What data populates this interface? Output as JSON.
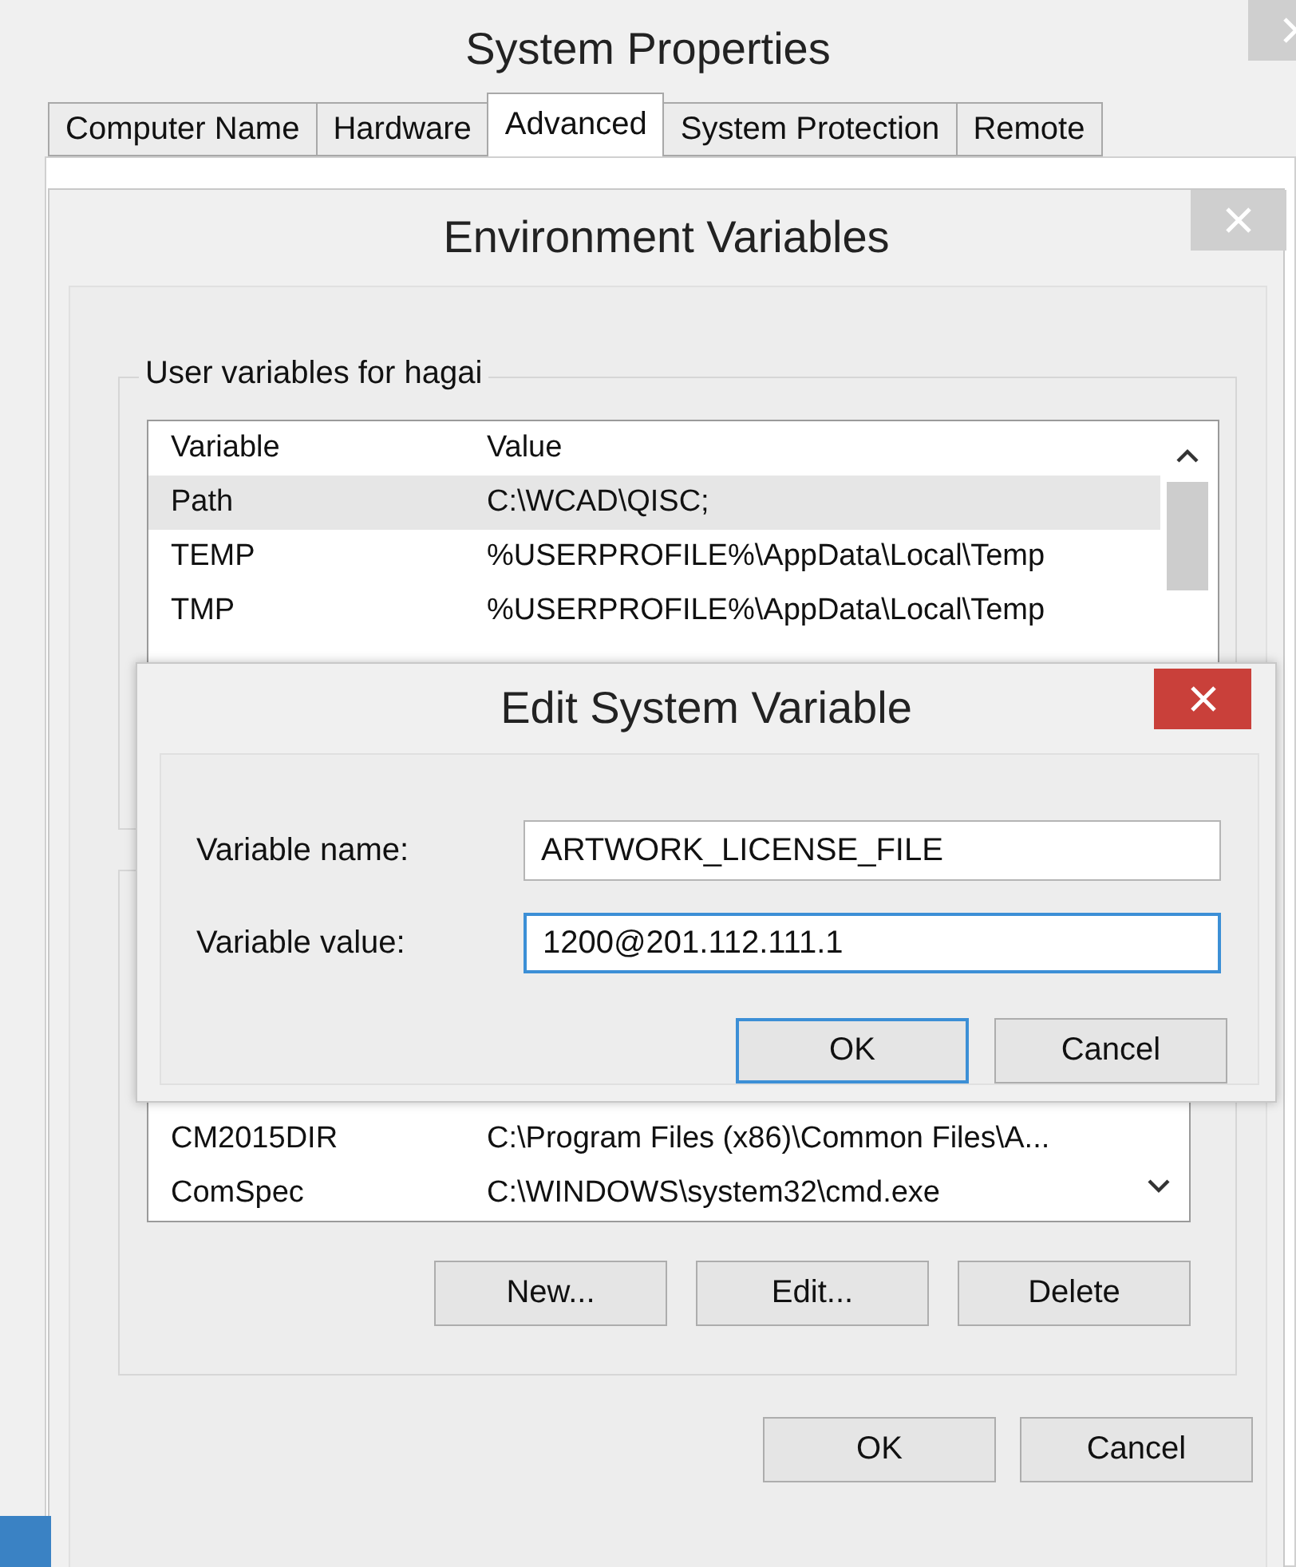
{
  "system_properties": {
    "title": "System Properties",
    "tabs": [
      {
        "label": "Computer Name",
        "selected": false
      },
      {
        "label": "Hardware",
        "selected": false
      },
      {
        "label": "Advanced",
        "selected": true
      },
      {
        "label": "System Protection",
        "selected": false
      },
      {
        "label": "Remote",
        "selected": false
      }
    ]
  },
  "environment_variables": {
    "title": "Environment Variables",
    "user_variables": {
      "label": "User variables for hagai",
      "columns": [
        "Variable",
        "Value"
      ],
      "rows": [
        {
          "variable": "Path",
          "value": "C:\\WCAD\\QISC;",
          "selected": true
        },
        {
          "variable": "TEMP",
          "value": "%USERPROFILE%\\AppData\\Local\\Temp",
          "selected": false
        },
        {
          "variable": "TMP",
          "value": "%USERPROFILE%\\AppData\\Local\\Temp",
          "selected": false
        }
      ]
    },
    "system_variables": {
      "rows": [
        {
          "variable": "CM2015DIR",
          "value": "C:\\Program Files (x86)\\Common Files\\A...",
          "selected": false
        },
        {
          "variable": "ComSpec",
          "value": "C:\\WINDOWS\\system32\\cmd.exe",
          "selected": false
        }
      ],
      "buttons": [
        "New...",
        "Edit...",
        "Delete"
      ]
    },
    "buttons": [
      "OK",
      "Cancel"
    ]
  },
  "edit_system_variable": {
    "title": "Edit System Variable",
    "fields": [
      {
        "label": "Variable name:",
        "value": "ARTWORK_LICENSE_FILE",
        "focused": false
      },
      {
        "label": "Variable value:",
        "value": "1200@201.112.111.1",
        "focused": true
      }
    ],
    "buttons": [
      {
        "label": "OK",
        "default": true
      },
      {
        "label": "Cancel",
        "default": false
      }
    ]
  }
}
